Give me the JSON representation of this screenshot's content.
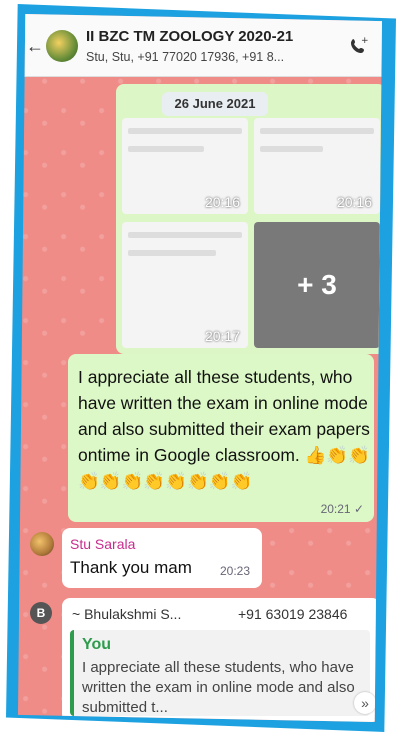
{
  "chat": {
    "title": "II BZC TM ZOOLOGY 2020-21",
    "subtitle": "Stu, Stu, +91 77020 17936, +91 8..."
  },
  "media": {
    "date": "26 June 2021",
    "times": [
      "20:16",
      "20:16",
      "20:17"
    ],
    "more_count": "+ 3"
  },
  "messages": {
    "outgoing": {
      "text": "I appreciate all these students,  who have written the exam in online mode and also submitted their exam papers ontime in Google classroom. 👍👏👏👏👏👏👏👏👏👏👏",
      "time": "20:21 ✓"
    },
    "incoming": {
      "name": "Stu Sarala",
      "text": "Thank you mam",
      "time": "20:23"
    },
    "reply": {
      "badge": "B",
      "sender": "~ Bhulakshmi S...",
      "phone": "+91 63019 23846",
      "quoted_you": "You",
      "quoted_text": "I appreciate all these students, who have written the exam in online mode and also submitted t..."
    }
  },
  "icons": {
    "back": "←",
    "scroll_down": "»"
  }
}
